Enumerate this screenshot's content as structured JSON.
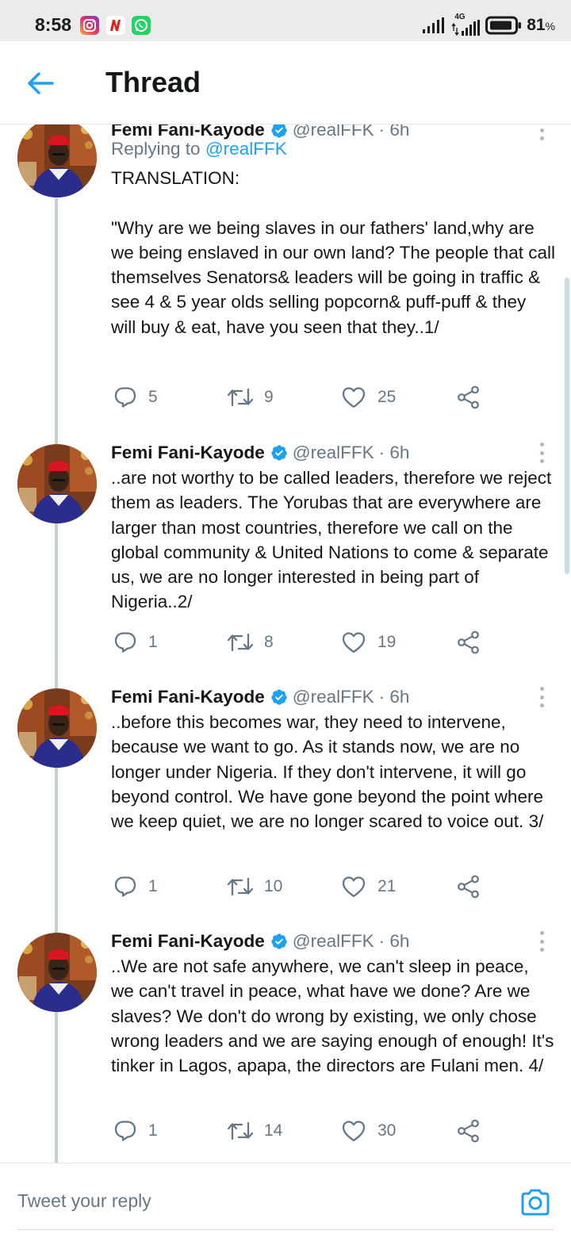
{
  "status_bar": {
    "time": "8:58",
    "network": "4G",
    "battery": "81",
    "battery_unit": "%",
    "apps": [
      "instagram-icon",
      "news-app-icon",
      "whatsapp-icon"
    ]
  },
  "header": {
    "title": "Thread",
    "back_icon": "arrow-left-icon"
  },
  "colors": {
    "accent": "#1da1f2",
    "secondary_text": "#657786",
    "thread_line": "#c4cfd6"
  },
  "tweets": [
    {
      "name": "Femi Fani-Kayode",
      "handle": "@realFFK",
      "time": "· 6h",
      "replying_label": "Replying to",
      "replying_handle": "@realFFK",
      "text": "TRANSLATION:\n\n\"Why are we being slaves in our fathers' land,why are we being enslaved in our own land? The people that call themselves Senators& leaders will be going in traffic & see 4 & 5 year olds selling popcorn& puff-puff & they will buy & eat, have you seen that they..1/",
      "replies": "5",
      "retweets": "9",
      "likes": "25"
    },
    {
      "name": "Femi Fani-Kayode",
      "handle": "@realFFK",
      "time": "· 6h",
      "text": "..are not worthy to be called leaders, therefore we reject them as leaders. The Yorubas that are everywhere are larger than most countries, therefore we call on the global community & United Nations to come & separate us, we are no longer interested in being part of Nigeria..2/",
      "replies": "1",
      "retweets": "8",
      "likes": "19"
    },
    {
      "name": "Femi Fani-Kayode",
      "handle": "@realFFK",
      "time": "· 6h",
      "text": "..before this becomes war, they need to intervene, because we want to go. As it stands now, we are no longer under Nigeria. If they don't intervene, it will go beyond control. We have gone beyond the point where we keep quiet, we are no longer scared to voice out. 3/",
      "replies": "1",
      "retweets": "10",
      "likes": "21"
    },
    {
      "name": "Femi Fani-Kayode",
      "handle": "@realFFK",
      "time": "· 6h",
      "text": "..We are not safe anywhere, we can't sleep in peace, we can't travel in peace, what have we done? Are we slaves? We don't do wrong by existing, we only chose wrong leaders and we are saying enough of enough! It's tinker in Lagos, apapa, the directors are Fulani men. 4/",
      "replies": "1",
      "retweets": "14",
      "likes": "30"
    }
  ],
  "reply": {
    "placeholder": "Tweet your reply",
    "camera_icon": "camera-icon"
  }
}
